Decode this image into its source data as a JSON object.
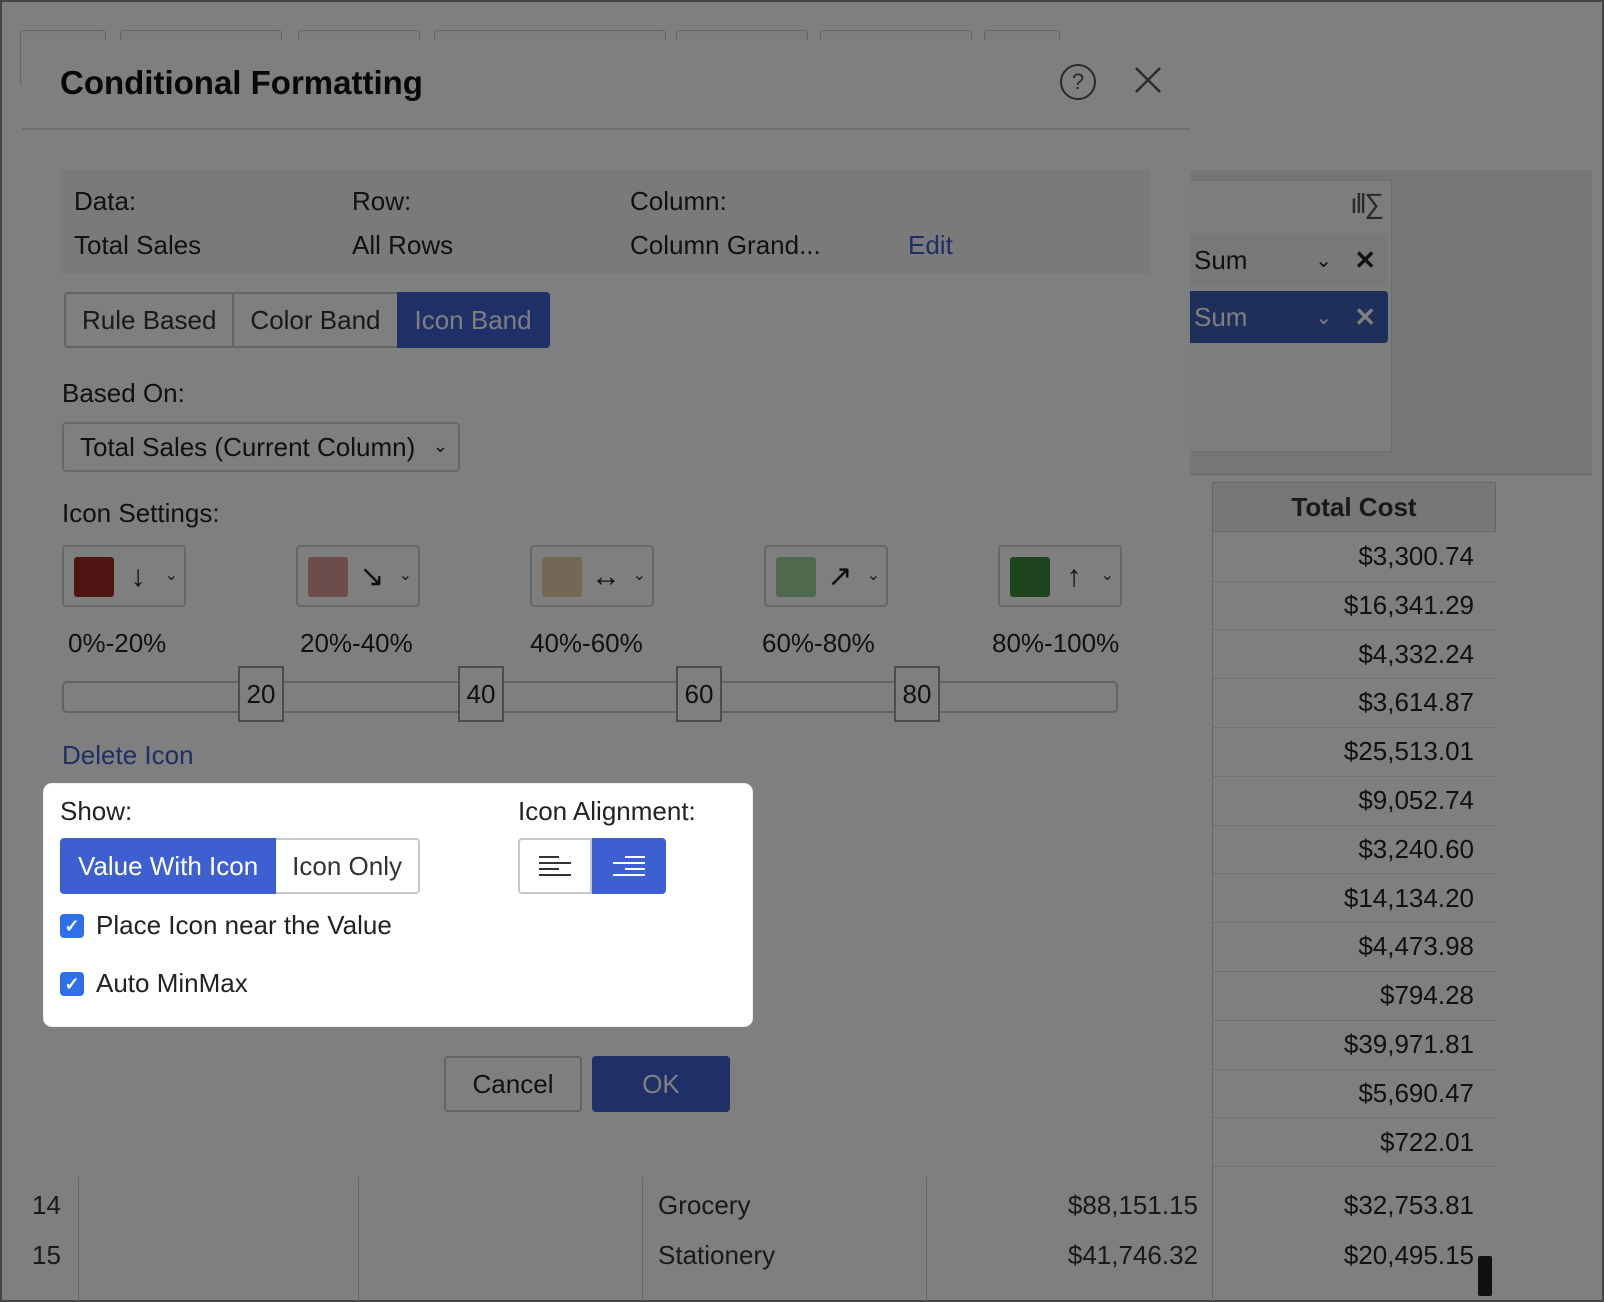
{
  "background": {
    "field_panel": {
      "chips": [
        {
          "label": "Sum"
        },
        {
          "label": "Sum"
        }
      ]
    },
    "table": {
      "total_cost_header": "Total Cost",
      "total_cost_values": [
        "$3,300.74",
        "$16,341.29",
        "$4,332.24",
        "$3,614.87",
        "$25,513.01",
        "$9,052.74",
        "$3,240.60",
        "$14,134.20",
        "$4,473.98",
        "$794.28",
        "$39,971.81",
        "$5,690.47",
        "$722.01"
      ],
      "rows": [
        {
          "num": "14",
          "category": "Grocery",
          "sales": "$88,151.15",
          "cost": "$32,753.81"
        },
        {
          "num": "15",
          "category": "Stationery",
          "sales": "$41,746.32",
          "cost": "$20,495.15"
        }
      ]
    }
  },
  "dialog": {
    "title": "Conditional Formatting",
    "info": {
      "data_label": "Data:",
      "data_value": "Total Sales",
      "row_label": "Row:",
      "row_value": "All Rows",
      "column_label": "Column:",
      "column_value": "Column Grand...",
      "edit_link": "Edit"
    },
    "tabs": [
      "Rule Based",
      "Color Band",
      "Icon Band"
    ],
    "active_tab": "Icon Band",
    "based_on": {
      "label": "Based On:",
      "value": "Total Sales (Current Column)"
    },
    "icon_settings": {
      "label": "Icon Settings:",
      "icons": [
        {
          "color": "#9e2b27",
          "arrow": "↓",
          "range": "0%-20%"
        },
        {
          "color": "#d99a98",
          "arrow": "↘",
          "range": "20%-40%"
        },
        {
          "color": "#e8cfae",
          "arrow": "↔",
          "range": "40%-60%"
        },
        {
          "color": "#9fd29c",
          "arrow": "↗",
          "range": "60%-80%"
        },
        {
          "color": "#3f8a3c",
          "arrow": "↑",
          "range": "80%-100%"
        }
      ],
      "slider_stops": [
        "20",
        "40",
        "60",
        "80"
      ]
    },
    "delete_icon_link": "Delete Icon",
    "show": {
      "label": "Show:",
      "options": [
        "Value With Icon",
        "Icon Only"
      ],
      "selected": "Value With Icon"
    },
    "icon_alignment": {
      "label": "Icon Alignment:",
      "selected": "right"
    },
    "checkboxes": [
      {
        "label": "Place Icon near the Value",
        "checked": true
      },
      {
        "label": "Auto MinMax",
        "checked": true
      }
    ],
    "cancel_label": "Cancel",
    "ok_label": "OK"
  },
  "colors": {
    "accent": "#3e5fd0",
    "link": "#3b5fc7"
  }
}
